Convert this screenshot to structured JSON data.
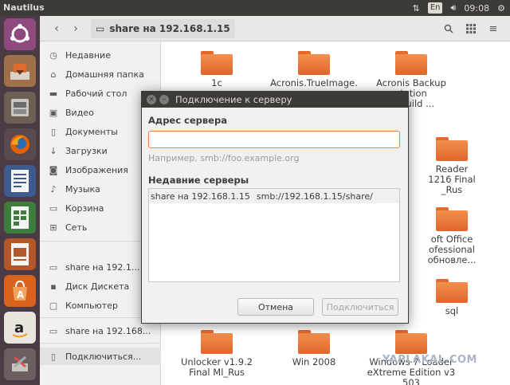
{
  "top_panel": {
    "app_name": "Nautilus",
    "keyboard_layout": "En",
    "clock": "09:08"
  },
  "launcher": {
    "items": [
      "ubuntu-dash",
      "files",
      "file-manager",
      "firefox",
      "writer",
      "calc",
      "impress",
      "software-center",
      "amazon",
      "system-tools"
    ]
  },
  "toolbar": {
    "path_label": "share на 192.168.1.15"
  },
  "sidebar": {
    "items": [
      {
        "icon": "recent-icon",
        "label": "Недавние"
      },
      {
        "icon": "home-icon",
        "label": "Домашняя папка"
      },
      {
        "icon": "desktop-icon",
        "label": "Рабочий стол"
      },
      {
        "icon": "video-icon",
        "label": "Видео"
      },
      {
        "icon": "document-icon",
        "label": "Документы"
      },
      {
        "icon": "download-icon",
        "label": "Загрузки"
      },
      {
        "icon": "camera-icon",
        "label": "Изображения"
      },
      {
        "icon": "music-icon",
        "label": "Музыка"
      },
      {
        "icon": "trash-icon",
        "label": "Корзина"
      },
      {
        "icon": "network-icon",
        "label": "Сеть"
      },
      {
        "icon": "network-share-icon",
        "label": "share на 192.1..."
      },
      {
        "icon": "floppy-icon",
        "label": "Диск Дискета"
      },
      {
        "icon": "computer-icon",
        "label": "Компьютер"
      },
      {
        "icon": "network-share-icon",
        "label": "share на 192.168..."
      },
      {
        "icon": "connect-icon",
        "label": "Подключиться..."
      }
    ]
  },
  "files": {
    "items": [
      {
        "line1": "1c",
        "line2": ""
      },
      {
        "line1": "Acronis.TrueImage.",
        "line2": ""
      },
      {
        "line1": "Acronis Backup",
        "line2": "station",
        "line3": ".5 Build ..."
      },
      {
        "line1": "Reader",
        "line2": "1216 Final",
        "line3": "_Rus"
      },
      {
        "line1": "oft Office",
        "line2": "ofessional",
        "line3": "обновле..."
      },
      {
        "line1": "sql",
        "line2": ""
      },
      {
        "line1": "Unlocker v1.9.2",
        "line2": "Final Ml_Rus"
      },
      {
        "line1": "Win 2008",
        "line2": ""
      },
      {
        "line1": "Windows 7 Loader",
        "line2": "eXtreme Edition v3",
        "line3": "503"
      }
    ]
  },
  "watermark": "YAPLAKAL.COM",
  "dialog": {
    "title": "Подключение к серверу",
    "server_address_label": "Адрес сервера",
    "server_address_value": "",
    "hint": "Например, smb://foo.example.org",
    "recent_label": "Недавние серверы",
    "recent_servers": [
      {
        "name": "share на 192.168.1.15",
        "uri": "smb://192.168.1.15/share/"
      }
    ],
    "cancel_label": "Отмена",
    "connect_label": "Подключиться"
  },
  "colors": {
    "panel": "#3c3b37",
    "launcher": "#4a3b44",
    "accent": "#e4864a",
    "folder": "#e8702f"
  }
}
